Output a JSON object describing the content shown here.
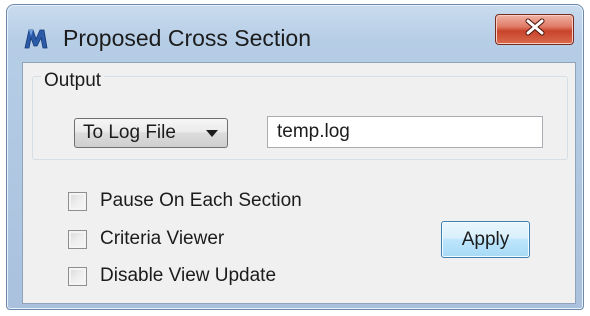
{
  "window": {
    "title": "Proposed Cross Section",
    "icon": "app-logo-icon",
    "close_icon": "close-icon",
    "accent_close": "#c8442b"
  },
  "output_group": {
    "label": "Output",
    "dropdown": {
      "selected": "To Log File",
      "icon": "chevron-down-icon"
    },
    "file_input": {
      "value": "temp.log"
    }
  },
  "options": {
    "pause_on_each_section": {
      "label": "Pause On Each Section",
      "checked": false
    },
    "criteria_viewer": {
      "label": "Criteria Viewer",
      "checked": false
    },
    "disable_view_update": {
      "label": "Disable View Update",
      "checked": false
    }
  },
  "buttons": {
    "apply": "Apply"
  }
}
